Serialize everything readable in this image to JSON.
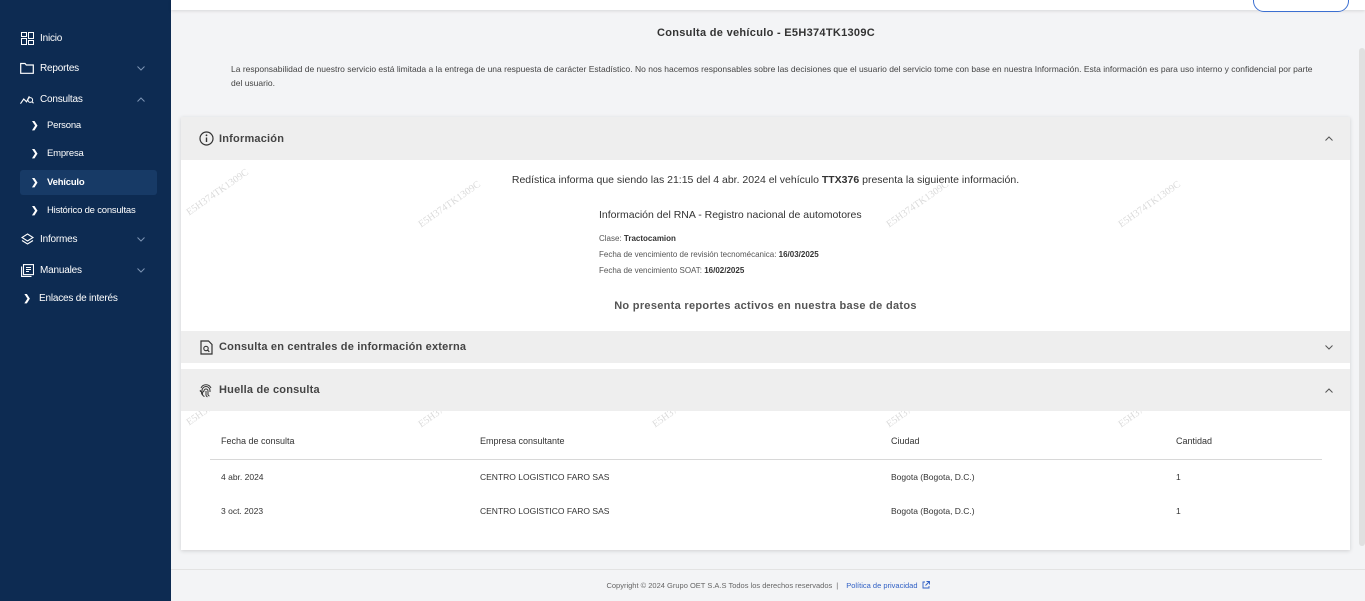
{
  "sidebar": {
    "items": [
      {
        "label": "Inicio",
        "icon": "dashboard-icon"
      },
      {
        "label": "Reportes",
        "icon": "folder-icon"
      },
      {
        "label": "Consultas",
        "icon": "search-chart-icon"
      },
      {
        "label": "Informes",
        "icon": "layers-icon"
      },
      {
        "label": "Manuales",
        "icon": "book-icon"
      },
      {
        "label": "Enlaces de interés",
        "icon": "chevron-right-icon"
      }
    ],
    "sub_items": [
      {
        "label": "Persona"
      },
      {
        "label": "Empresa"
      },
      {
        "label": "Vehículo",
        "active": true
      },
      {
        "label": "Histórico de consultas"
      }
    ]
  },
  "page": {
    "title": "Consulta de vehículo - E5H374TK1309C",
    "disclaimer": "La responsabilidad de nuestro servicio está limitada a la entrega de una respuesta de carácter Estadístico. No nos hacemos responsables sobre las decisiones que el usuario del servicio tome con base en nuestra Información. Esta información es para uso interno y confidencial por parte del usuario.",
    "watermark": "E5H374TK1309C"
  },
  "info_section": {
    "title": "Información",
    "statement_prefix": "Redística informa que siendo las 21:15 del 4 abr. 2024 el vehículo ",
    "plate": "TTX376",
    "statement_suffix": " presenta la siguiente información.",
    "rna_title": "Información del RNA - Registro nacional de automotores",
    "rows": [
      {
        "label": "Clase: ",
        "value": "Tractocamion"
      },
      {
        "label": "Fecha de vencimiento de revisión tecnomécanica: ",
        "value": "16/03/2025"
      },
      {
        "label": "Fecha de vencimiento SOAT: ",
        "value": "16/02/2025"
      }
    ],
    "no_reports": "No presenta reportes activos en nuestra base de datos"
  },
  "external_section": {
    "title": "Consulta en centrales de información externa"
  },
  "footprint_section": {
    "title": "Huella de consulta",
    "columns": [
      "Fecha de consulta",
      "Empresa consultante",
      "Ciudad",
      "Cantidad"
    ],
    "rows": [
      [
        "4 abr. 2024",
        "CENTRO LOGISTICO FARO SAS",
        "Bogota (Bogota, D.C.)",
        "1"
      ],
      [
        "3 oct. 2023",
        "CENTRO LOGISTICO FARO SAS",
        "Bogota (Bogota, D.C.)",
        "1"
      ]
    ]
  },
  "footer": {
    "copyright": "Copyright © 2024 Grupo OET S.A.S Todos los derechos reservados",
    "separator": "|",
    "privacy_link": "Política de privacidad"
  },
  "colors": {
    "sidebar_bg": "#0d2b52",
    "sidebar_active": "#173a66",
    "accent": "#2f5fc4",
    "section_header_bg": "#eeeeee"
  }
}
